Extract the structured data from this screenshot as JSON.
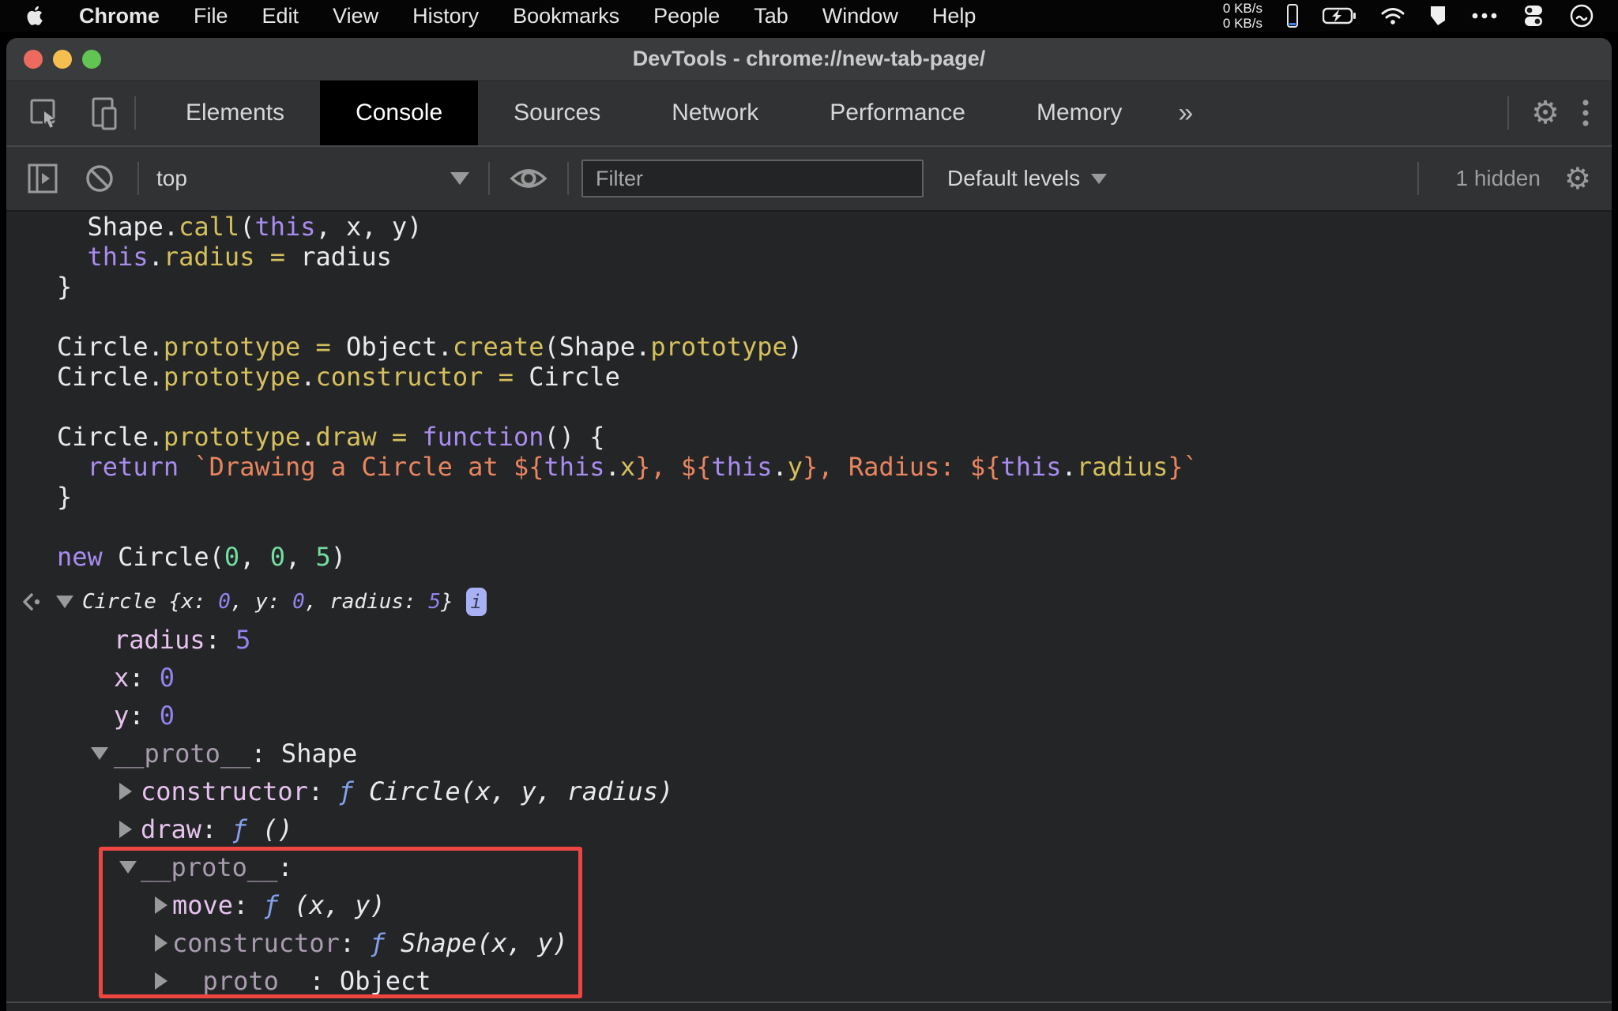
{
  "colors": {
    "plain": "#e8eaed",
    "kw": "#a98cf0",
    "fn": "#d5c05c",
    "str": "#e8855f",
    "num": "#74dda2",
    "vnum": "#9184ee",
    "prop": "#e6c3ee",
    "dimp": "#a89cae",
    "fsym": "#85a1ee",
    "annotation": "#ee4540",
    "badge-bg": "#a7b1f4",
    "badge-fg": "#343a55"
  },
  "menubar": {
    "items": [
      "Chrome",
      "File",
      "Edit",
      "View",
      "History",
      "Bookmarks",
      "People",
      "Tab",
      "Window",
      "Help"
    ],
    "status": {
      "up": "0 KB/s",
      "down": "0 KB/s"
    }
  },
  "titlebar": {
    "title": "DevTools - chrome://new-tab-page/"
  },
  "tabbar": {
    "tabs": [
      {
        "label": "Elements",
        "active": false
      },
      {
        "label": "Console",
        "active": true
      },
      {
        "label": "Sources",
        "active": false
      },
      {
        "label": "Network",
        "active": false
      },
      {
        "label": "Performance",
        "active": false
      },
      {
        "label": "Memory",
        "active": false
      }
    ],
    "overflow": "»",
    "gear_glyph": "⚙"
  },
  "toolbar": {
    "context": "top",
    "filter_placeholder": "Filter",
    "levels": "Default levels",
    "hidden": "1 hidden",
    "gear_glyph": "⚙"
  },
  "console": {
    "source_lines": [
      [
        {
          "c": "pl",
          "t": "  Shape."
        },
        {
          "c": "fn",
          "t": "call"
        },
        {
          "c": "pl",
          "t": "("
        },
        {
          "c": "kw",
          "t": "this"
        },
        {
          "c": "pl",
          "t": ", x, y)"
        }
      ],
      [
        {
          "c": "pl",
          "t": "  "
        },
        {
          "c": "kw",
          "t": "this"
        },
        {
          "c": "pl",
          "t": "."
        },
        {
          "c": "fn",
          "t": "radius"
        },
        {
          "c": "pl",
          "t": " "
        },
        {
          "c": "fn",
          "t": "="
        },
        {
          "c": "pl",
          "t": " radius"
        }
      ],
      [
        {
          "c": "pl",
          "t": "}"
        }
      ],
      [],
      [
        {
          "c": "pl",
          "t": "Circle."
        },
        {
          "c": "fn",
          "t": "prototype"
        },
        {
          "c": "pl",
          "t": " "
        },
        {
          "c": "fn",
          "t": "="
        },
        {
          "c": "pl",
          "t": " Object."
        },
        {
          "c": "fn",
          "t": "create"
        },
        {
          "c": "pl",
          "t": "(Shape."
        },
        {
          "c": "fn",
          "t": "prototype"
        },
        {
          "c": "pl",
          "t": ")"
        }
      ],
      [
        {
          "c": "pl",
          "t": "Circle."
        },
        {
          "c": "fn",
          "t": "prototype"
        },
        {
          "c": "pl",
          "t": "."
        },
        {
          "c": "fn",
          "t": "constructor"
        },
        {
          "c": "pl",
          "t": " "
        },
        {
          "c": "fn",
          "t": "="
        },
        {
          "c": "pl",
          "t": " Circle"
        }
      ],
      [],
      [
        {
          "c": "pl",
          "t": "Circle."
        },
        {
          "c": "fn",
          "t": "prototype"
        },
        {
          "c": "pl",
          "t": "."
        },
        {
          "c": "fn",
          "t": "draw"
        },
        {
          "c": "pl",
          "t": " "
        },
        {
          "c": "fn",
          "t": "="
        },
        {
          "c": "pl",
          "t": " "
        },
        {
          "c": "kw",
          "t": "function"
        },
        {
          "c": "pl",
          "t": "() {"
        }
      ],
      [
        {
          "c": "pl",
          "t": "  "
        },
        {
          "c": "kw",
          "t": "return"
        },
        {
          "c": "pl",
          "t": " "
        },
        {
          "c": "str",
          "t": "`Drawing a Circle at ${"
        },
        {
          "c": "kw",
          "t": "this"
        },
        {
          "c": "pl",
          "t": "."
        },
        {
          "c": "fn",
          "t": "x"
        },
        {
          "c": "str",
          "t": "}, ${"
        },
        {
          "c": "kw",
          "t": "this"
        },
        {
          "c": "pl",
          "t": "."
        },
        {
          "c": "fn",
          "t": "y"
        },
        {
          "c": "str",
          "t": "}, Radius: ${"
        },
        {
          "c": "kw",
          "t": "this"
        },
        {
          "c": "pl",
          "t": "."
        },
        {
          "c": "fn",
          "t": "radius"
        },
        {
          "c": "str",
          "t": "}`"
        }
      ],
      [
        {
          "c": "pl",
          "t": "}"
        }
      ],
      [],
      [
        {
          "c": "kw",
          "t": "new"
        },
        {
          "c": "pl",
          "t": " Circle("
        },
        {
          "c": "num",
          "t": "0"
        },
        {
          "c": "pl",
          "t": ", "
        },
        {
          "c": "num",
          "t": "0"
        },
        {
          "c": "pl",
          "t": ", "
        },
        {
          "c": "num",
          "t": "5"
        },
        {
          "c": "pl",
          "t": ")"
        }
      ]
    ],
    "result": {
      "preview": [
        {
          "c": "pl",
          "t": "Circle {x: "
        },
        {
          "c": "vnum",
          "t": "0"
        },
        {
          "c": "pl",
          "t": ", y: "
        },
        {
          "c": "vnum",
          "t": "0"
        },
        {
          "c": "pl",
          "t": ", radius: "
        },
        {
          "c": "vnum",
          "t": "5"
        },
        {
          "c": "pl",
          "t": "}"
        }
      ],
      "info_badge": "i",
      "rows": [
        {
          "level": 1,
          "arrow": "none",
          "tokens": [
            {
              "c": "prop",
              "t": "radius"
            },
            {
              "c": "pl",
              "t": ": "
            },
            {
              "c": "vnum",
              "t": "5"
            }
          ]
        },
        {
          "level": 1,
          "arrow": "none",
          "tokens": [
            {
              "c": "prop",
              "t": "x"
            },
            {
              "c": "pl",
              "t": ": "
            },
            {
              "c": "vnum",
              "t": "0"
            }
          ]
        },
        {
          "level": 1,
          "arrow": "none",
          "tokens": [
            {
              "c": "prop",
              "t": "y"
            },
            {
              "c": "pl",
              "t": ": "
            },
            {
              "c": "vnum",
              "t": "0"
            }
          ]
        },
        {
          "level": 1,
          "arrow": "down",
          "tokens": [
            {
              "c": "dimp",
              "t": "__proto__"
            },
            {
              "c": "pl",
              "t": ": Shape"
            }
          ]
        },
        {
          "level": 2,
          "arrow": "right",
          "tokens": [
            {
              "c": "prop",
              "t": "constructor"
            },
            {
              "c": "pl",
              "t": ": "
            },
            {
              "c": "fsym",
              "t": "ƒ "
            },
            {
              "c": "sig",
              "t": "Circle(x, y, radius)"
            }
          ]
        },
        {
          "level": 2,
          "arrow": "right",
          "tokens": [
            {
              "c": "prop",
              "t": "draw"
            },
            {
              "c": "pl",
              "t": ": "
            },
            {
              "c": "fsym",
              "t": "ƒ "
            },
            {
              "c": "sig",
              "t": "()"
            }
          ]
        },
        {
          "level": 2,
          "arrow": "down",
          "tokens": [
            {
              "c": "dimp",
              "t": "__proto__"
            },
            {
              "c": "pl",
              "t": ":"
            }
          ]
        },
        {
          "level": 3,
          "arrow": "right",
          "tokens": [
            {
              "c": "prop",
              "t": "move"
            },
            {
              "c": "pl",
              "t": ": "
            },
            {
              "c": "fsym",
              "t": "ƒ "
            },
            {
              "c": "sig",
              "t": "(x, y)"
            }
          ]
        },
        {
          "level": 3,
          "arrow": "right",
          "tokens": [
            {
              "c": "dimp",
              "t": "constructor"
            },
            {
              "c": "pl",
              "t": ": "
            },
            {
              "c": "fsym",
              "t": "ƒ "
            },
            {
              "c": "sig",
              "t": "Shape(x, y)"
            }
          ]
        },
        {
          "level": 3,
          "arrow": "right",
          "tokens": [
            {
              "c": "dimp",
              "t": "__proto__"
            },
            {
              "c": "pl",
              "t": ": Object"
            }
          ]
        }
      ]
    }
  }
}
